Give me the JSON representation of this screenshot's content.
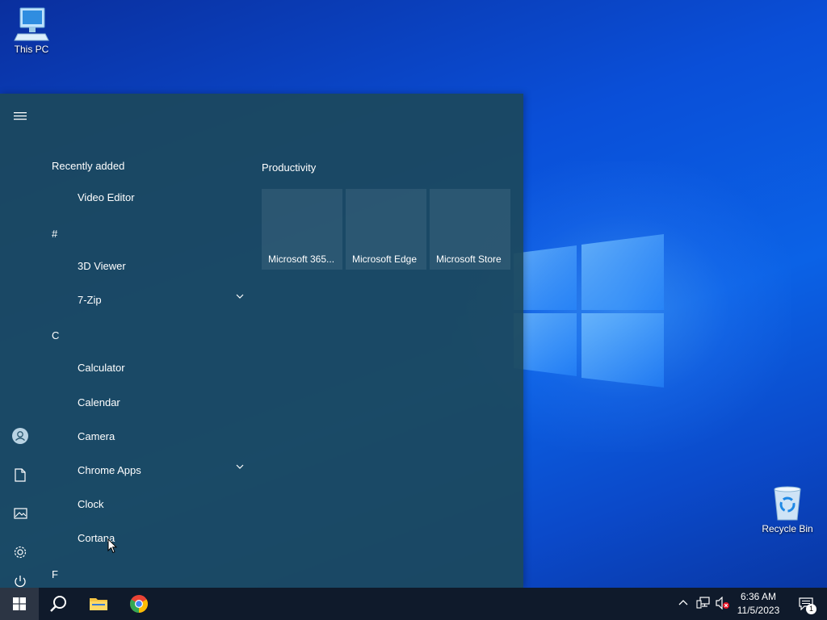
{
  "desktop": {
    "icons": [
      {
        "label": "This PC",
        "icon": "computer-icon"
      },
      {
        "label": "Recycle Bin",
        "icon": "recycle-bin-icon"
      }
    ],
    "wallpaper": {
      "accent": "#0b62e6",
      "logo": "windows-logo"
    }
  },
  "start_menu": {
    "background": "#1c485c",
    "rail": [
      {
        "name": "hamburger-menu-icon"
      },
      {
        "name": "user-account-icon"
      },
      {
        "name": "documents-icon"
      },
      {
        "name": "pictures-icon"
      },
      {
        "name": "settings-icon"
      },
      {
        "name": "power-icon"
      }
    ],
    "app_list": {
      "recently_added_label": "Recently added",
      "groups": [
        {
          "header": "#"
        },
        {
          "header": "C"
        },
        {
          "header": "F"
        }
      ],
      "items": [
        {
          "label": "Video Editor"
        },
        {
          "label": "3D Viewer"
        },
        {
          "label": "7-Zip",
          "expandable": true
        },
        {
          "label": "Calculator"
        },
        {
          "label": "Calendar"
        },
        {
          "label": "Camera"
        },
        {
          "label": "Chrome Apps",
          "expandable": true
        },
        {
          "label": "Clock"
        },
        {
          "label": "Cortana"
        }
      ]
    },
    "tiles": {
      "group_title": "Productivity",
      "items": [
        {
          "label": "Microsoft 365..."
        },
        {
          "label": "Microsoft Edge"
        },
        {
          "label": "Microsoft Store"
        }
      ]
    }
  },
  "taskbar": {
    "background": "#0f1a2b",
    "buttons": [
      {
        "name": "start",
        "icon": "windows-start-icon"
      },
      {
        "name": "search",
        "icon": "search-icon"
      },
      {
        "name": "file-explorer",
        "icon": "folder-icon"
      },
      {
        "name": "chrome",
        "icon": "chrome-icon"
      }
    ],
    "tray": {
      "icons": [
        "chevron-up-icon",
        "network-icon",
        "volume-muted-icon"
      ],
      "time": "6:36 AM",
      "date": "11/5/2023",
      "notification_count": "1"
    }
  }
}
